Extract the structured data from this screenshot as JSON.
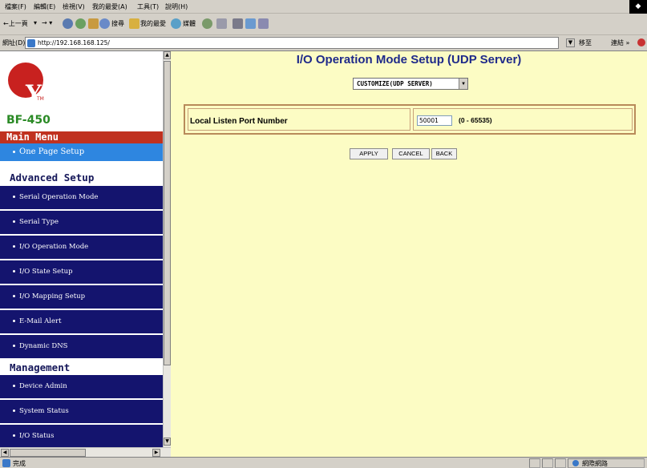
{
  "browser": {
    "menus": [
      "檔案(F)",
      "編輯(E)",
      "檢視(V)",
      "我的最愛(A)",
      "工具(T)",
      "說明(H)"
    ],
    "toolbar": {
      "back_label": "←上一頁",
      "search_label": "搜尋",
      "favorites_label": "我的最愛",
      "media_label": "媒體"
    },
    "address_label": "網址(D)",
    "url": "http://192.168.168.125/",
    "go_label": "移至",
    "links_label": "連結 »",
    "status_text": "完成",
    "zone_text": "網際網路"
  },
  "sidebar": {
    "logo_letters": "Yt",
    "logo_tm": "TM",
    "model": "BF-450",
    "main_menu_header": "Main Menu",
    "one_page_setup": "One Page Setup",
    "advanced_header": "Advanced Setup",
    "advanced_items": [
      "Serial Operation Mode",
      "Serial Type",
      "I/O Operation Mode",
      "I/O State Setup",
      "I/O Mapping Setup",
      "E-Mail Alert",
      "Dynamic DNS"
    ],
    "management_header": "Management",
    "management_items": [
      "Device Admin",
      "System Status",
      "I/O Status"
    ]
  },
  "main": {
    "title": "I/O Operation Mode Setup (UDP Server)",
    "mode_select_value": "CUSTOMIZE(UDP SERVER)",
    "port_label": "Local Listen Port Number",
    "port_value": "50001",
    "port_range": "(0 - 65535)",
    "buttons": {
      "apply": "APPLY",
      "cancel": "CANCEL",
      "back": "BACK"
    }
  },
  "colors": {
    "page_background": "#fcfcc4",
    "title_color": "#1f2a8a",
    "nav_dark": "#14146e",
    "nav_light": "#2e86e0",
    "main_menu_red": "#c0311f",
    "model_green": "#2a8a25"
  }
}
